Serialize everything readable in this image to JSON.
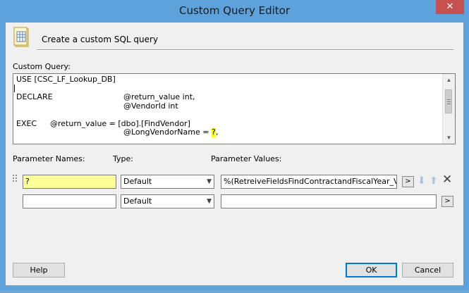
{
  "window": {
    "title": "Custom Query Editor",
    "close_glyph": "✕"
  },
  "header": {
    "icon": "sql-script-icon",
    "text": "Create a custom SQL query"
  },
  "query": {
    "label": "Custom Query:",
    "lines": [
      {
        "segments": [
          {
            "text": "USE [CSC_LF_Lookup_DB]"
          }
        ]
      },
      {
        "segments": []
      },
      {
        "segments": [
          {
            "text": "DECLARE"
          },
          {
            "text": "@return_value int,"
          }
        ]
      },
      {
        "segments": [
          {
            "text": "@VendorId int"
          }
        ]
      },
      {
        "segments": []
      },
      {
        "segments": [
          {
            "text": "EXEC"
          },
          {
            "text": "@return_value = [dbo].[FindVendor]"
          }
        ]
      },
      {
        "segments": [
          {
            "text": "@LongVendorName = "
          },
          {
            "text": "?",
            "highlight": true
          },
          {
            "text": ","
          }
        ]
      }
    ]
  },
  "parameters": {
    "names_label": "Parameter Names:",
    "type_label": "Type:",
    "values_label": "Parameter Values:",
    "rows": [
      {
        "name": "?",
        "type": "Default",
        "value": "%(RetreiveFieldsFindContractandFiscalYear_Vendo",
        "highlight": true
      },
      {
        "name": "",
        "type": "Default",
        "value": "",
        "highlight": false
      }
    ],
    "browse_label": ">",
    "move_down_icon": "arrow-down-icon",
    "move_up_icon": "arrow-up-icon",
    "delete_icon": "close-icon"
  },
  "buttons": {
    "help": "Help",
    "ok": "OK",
    "cancel": "Cancel"
  },
  "colors": {
    "title_bar": "#5ea2dc",
    "close_button": "#c75050",
    "highlight": "#ffff00",
    "default_button_border": "#0078d7"
  }
}
